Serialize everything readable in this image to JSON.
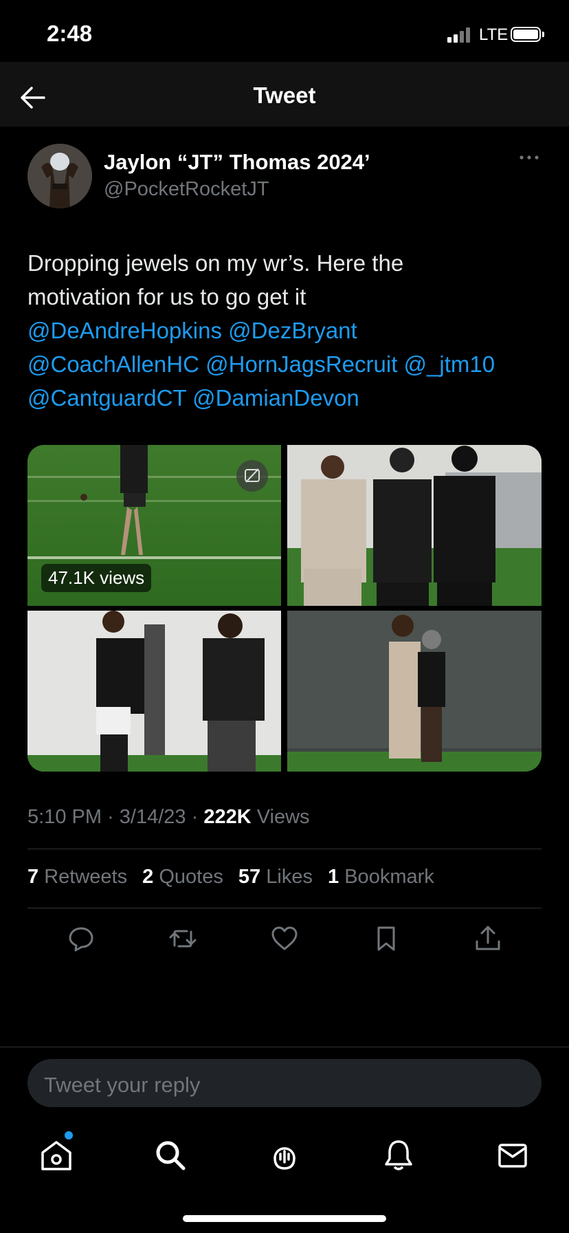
{
  "status_bar": {
    "time": "2:48",
    "network": "LTE"
  },
  "header": {
    "title": "Tweet"
  },
  "tweet": {
    "author_name": "Jaylon “JT” Thomas 2024’",
    "handle": "@PocketRocketJT",
    "text_line1": "Dropping jewels on my wr’s. Here the",
    "text_line2": "motivation for us to go get it",
    "mentions": [
      "@DeAndreHopkins",
      "@DezBryant",
      "@CoachAllenHC",
      "@HornJagsRecruit",
      "@_jtm10",
      "@CantguardCT",
      "@DamianDevon"
    ],
    "media_views": "47.1K views",
    "time": "5:10 PM",
    "date": "3/14/23",
    "views_count": "222K",
    "views_label": "Views",
    "stats": [
      {
        "count": "7",
        "label": "Retweets"
      },
      {
        "count": "2",
        "label": "Quotes"
      },
      {
        "count": "57",
        "label": "Likes"
      },
      {
        "count": "1",
        "label": "Bookmark"
      }
    ]
  },
  "reply": {
    "placeholder": "Tweet your reply"
  },
  "colors": {
    "accent": "#1d9bf0",
    "background": "#000000",
    "secondary_text": "#71767b"
  },
  "icons": [
    "back-arrow-icon",
    "more-icon",
    "reply-icon",
    "retweet-icon",
    "like-icon",
    "bookmark-icon",
    "share-icon",
    "home-icon",
    "search-icon",
    "spaces-icon",
    "notifications-icon",
    "messages-icon",
    "gif-icon"
  ]
}
